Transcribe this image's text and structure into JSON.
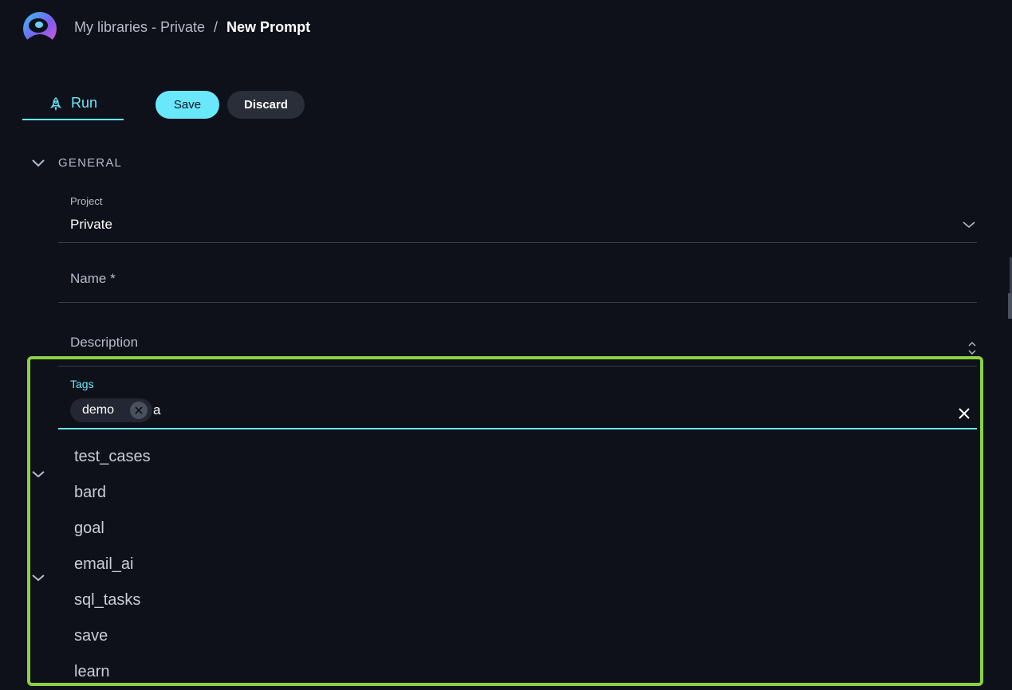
{
  "header": {
    "logo_icon": "app-logo-icon",
    "breadcrumb": {
      "parent": "My libraries - Private",
      "separator": "/",
      "current": "New Prompt"
    }
  },
  "toolbar": {
    "run_label": "Run",
    "run_icon": "rocket-icon",
    "save_label": "Save",
    "discard_label": "Discard"
  },
  "section": {
    "title": "GENERAL"
  },
  "fields": {
    "project": {
      "label": "Project",
      "value": "Private"
    },
    "name": {
      "placeholder": "Name *"
    },
    "description": {
      "placeholder": "Description"
    },
    "tags": {
      "label": "Tags",
      "chips": [
        "demo"
      ],
      "input_value": "a",
      "options": [
        "test_cases",
        "bard",
        "goal",
        "email_ai",
        "sql_tasks",
        "save",
        "learn"
      ]
    }
  },
  "colors": {
    "accent": "#6ae8fb",
    "background": "#0e111a",
    "highlight": "#8bd142"
  }
}
